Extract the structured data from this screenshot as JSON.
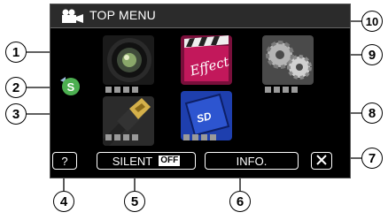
{
  "menu": {
    "title": "TOP MENU",
    "title_icon": "video-camera-icon"
  },
  "tiles": [
    {
      "name": "camera-lens-tile",
      "icon": "camera-lens-icon"
    },
    {
      "name": "effect-tile",
      "icon": "clapperboard-effect-icon"
    },
    {
      "name": "settings-tile",
      "icon": "gears-icon"
    },
    {
      "name": "hdmi-tile",
      "icon": "hdmi-cable-icon"
    },
    {
      "name": "sd-card-tile",
      "icon": "sd-card-icon"
    }
  ],
  "shortcut": {
    "icon": "s-badge-icon",
    "label": "S"
  },
  "effect_label": "Effect",
  "sd_label": "SD",
  "buttons": {
    "help": "?",
    "silent": "SILENT",
    "silent_state": "OFF",
    "info": "INFO.",
    "close_icon": "close-icon"
  },
  "callouts": [
    "1",
    "2",
    "3",
    "4",
    "5",
    "6",
    "7",
    "8",
    "9",
    "10"
  ],
  "colors": {
    "screen_bg": "#000000",
    "titlebar_bg": "#2b2b2b",
    "s_badge_green": "#4caf50",
    "sd_blue": "#1e3fae",
    "effect_pink": "#c2185b"
  }
}
